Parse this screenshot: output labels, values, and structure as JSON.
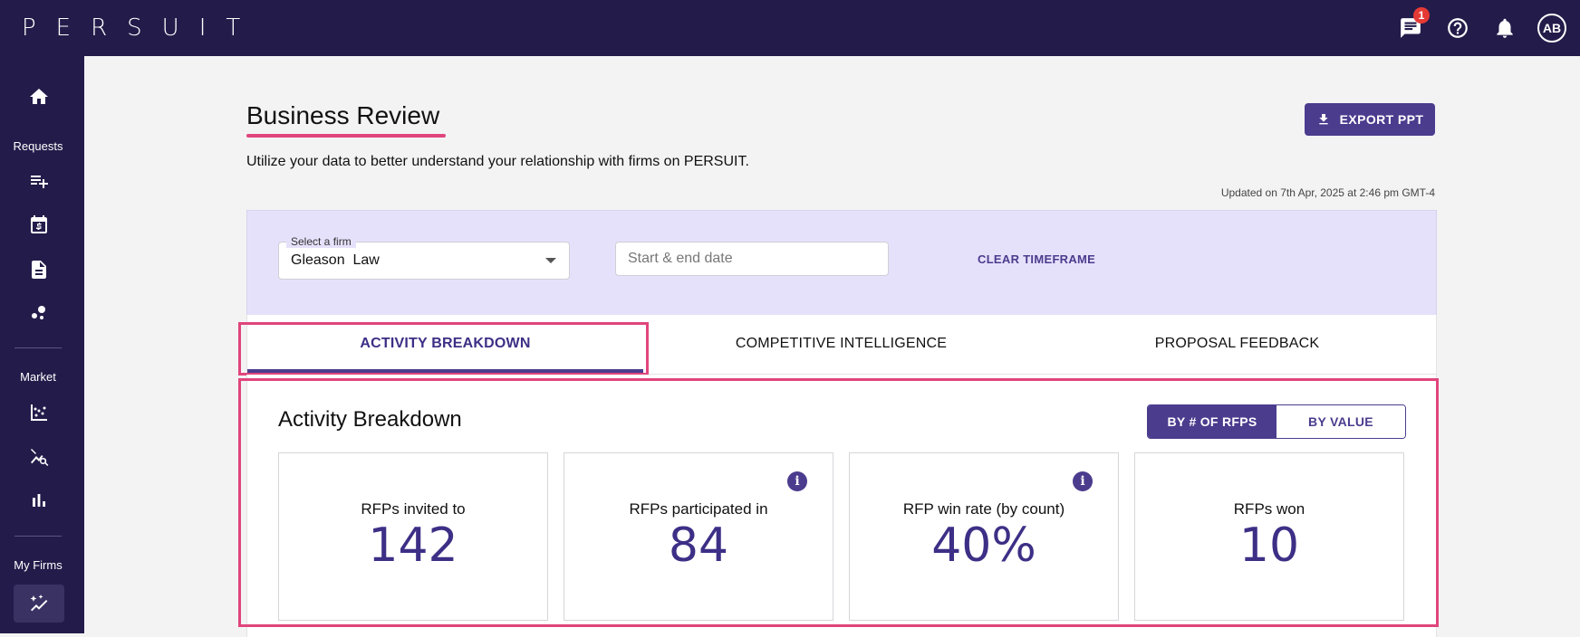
{
  "app": {
    "logo": "PERSUIT"
  },
  "topbar": {
    "notifications_count": "1",
    "avatar_initials": "AB"
  },
  "sidebar": {
    "section_requests": "Requests",
    "section_market": "Market",
    "section_my_firms": "My Firms"
  },
  "page": {
    "title": "Business Review",
    "subtitle": "Utilize your data to better understand your relationship with firms on PERSUIT.",
    "export_label": "EXPORT PPT",
    "updated_text": "Updated on 7th Apr, 2025 at 2:46 pm GMT-4"
  },
  "filters": {
    "firm_label": "Select a firm",
    "firm_value": "Gleason  Law",
    "date_placeholder": "Start & end date",
    "clear_label": "CLEAR TIMEFRAME"
  },
  "tabs": [
    {
      "label": "ACTIVITY BREAKDOWN",
      "active": true
    },
    {
      "label": "COMPETITIVE INTELLIGENCE",
      "active": false
    },
    {
      "label": "PROPOSAL FEEDBACK",
      "active": false
    }
  ],
  "activity": {
    "title": "Activity Breakdown",
    "toggle": {
      "by_count": "BY # OF RFPS",
      "by_value": "BY VALUE",
      "selected": "by_count"
    },
    "stats": [
      {
        "label": "RFPs invited to",
        "value": "142",
        "info": false
      },
      {
        "label": "RFPs participated in",
        "value": "84",
        "info": true
      },
      {
        "label": "RFP win rate (by count)",
        "value": "40%",
        "info": true
      },
      {
        "label": "RFPs won",
        "value": "10",
        "info": false
      }
    ],
    "info_glyph": "i"
  },
  "colors": {
    "nav_bg": "#231c4a",
    "accent": "#4b3c8e",
    "highlight": "#e0457b",
    "filter_bg": "#e6e1fb"
  },
  "icons": {
    "top": [
      "chat-icon",
      "help-icon",
      "bell-icon"
    ],
    "sidebar": [
      "home-icon",
      "new-request-icon",
      "calendar-dollar-icon",
      "document-icon",
      "network-icon",
      "scatter-chart-icon",
      "search-analytics-icon",
      "bar-chart-icon",
      "sparkle-chart-icon"
    ]
  }
}
